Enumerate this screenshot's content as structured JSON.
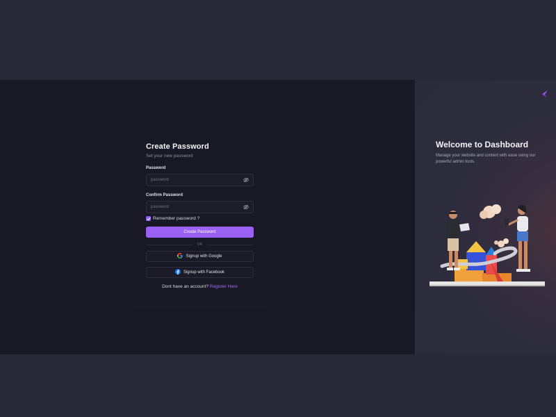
{
  "form": {
    "title": "Create Password",
    "subtitle": "Set your new password",
    "password_label": "Password",
    "password_placeholder": "password",
    "confirm_label": "Confirm Password",
    "confirm_placeholder": "password",
    "remember_label": "Remember password ?",
    "remember_checked": true,
    "submit_label": "Create Password",
    "divider_text": "OR",
    "google_label": "Signup with Google",
    "facebook_label": "Signup with Facebook",
    "signup_prompt": "Dont have an account?",
    "signup_link": "Register Here"
  },
  "panel": {
    "title": "Welcome to Dashboard",
    "description": "Manage your website and content with ease using our powerful admin tools."
  },
  "colors": {
    "accent": "#9b61f2",
    "background": "#191925",
    "panel": "#2d2c3d"
  },
  "icons": [
    "eye-off-icon",
    "check-icon",
    "google-icon",
    "facebook-icon",
    "brand-logo-icon"
  ]
}
